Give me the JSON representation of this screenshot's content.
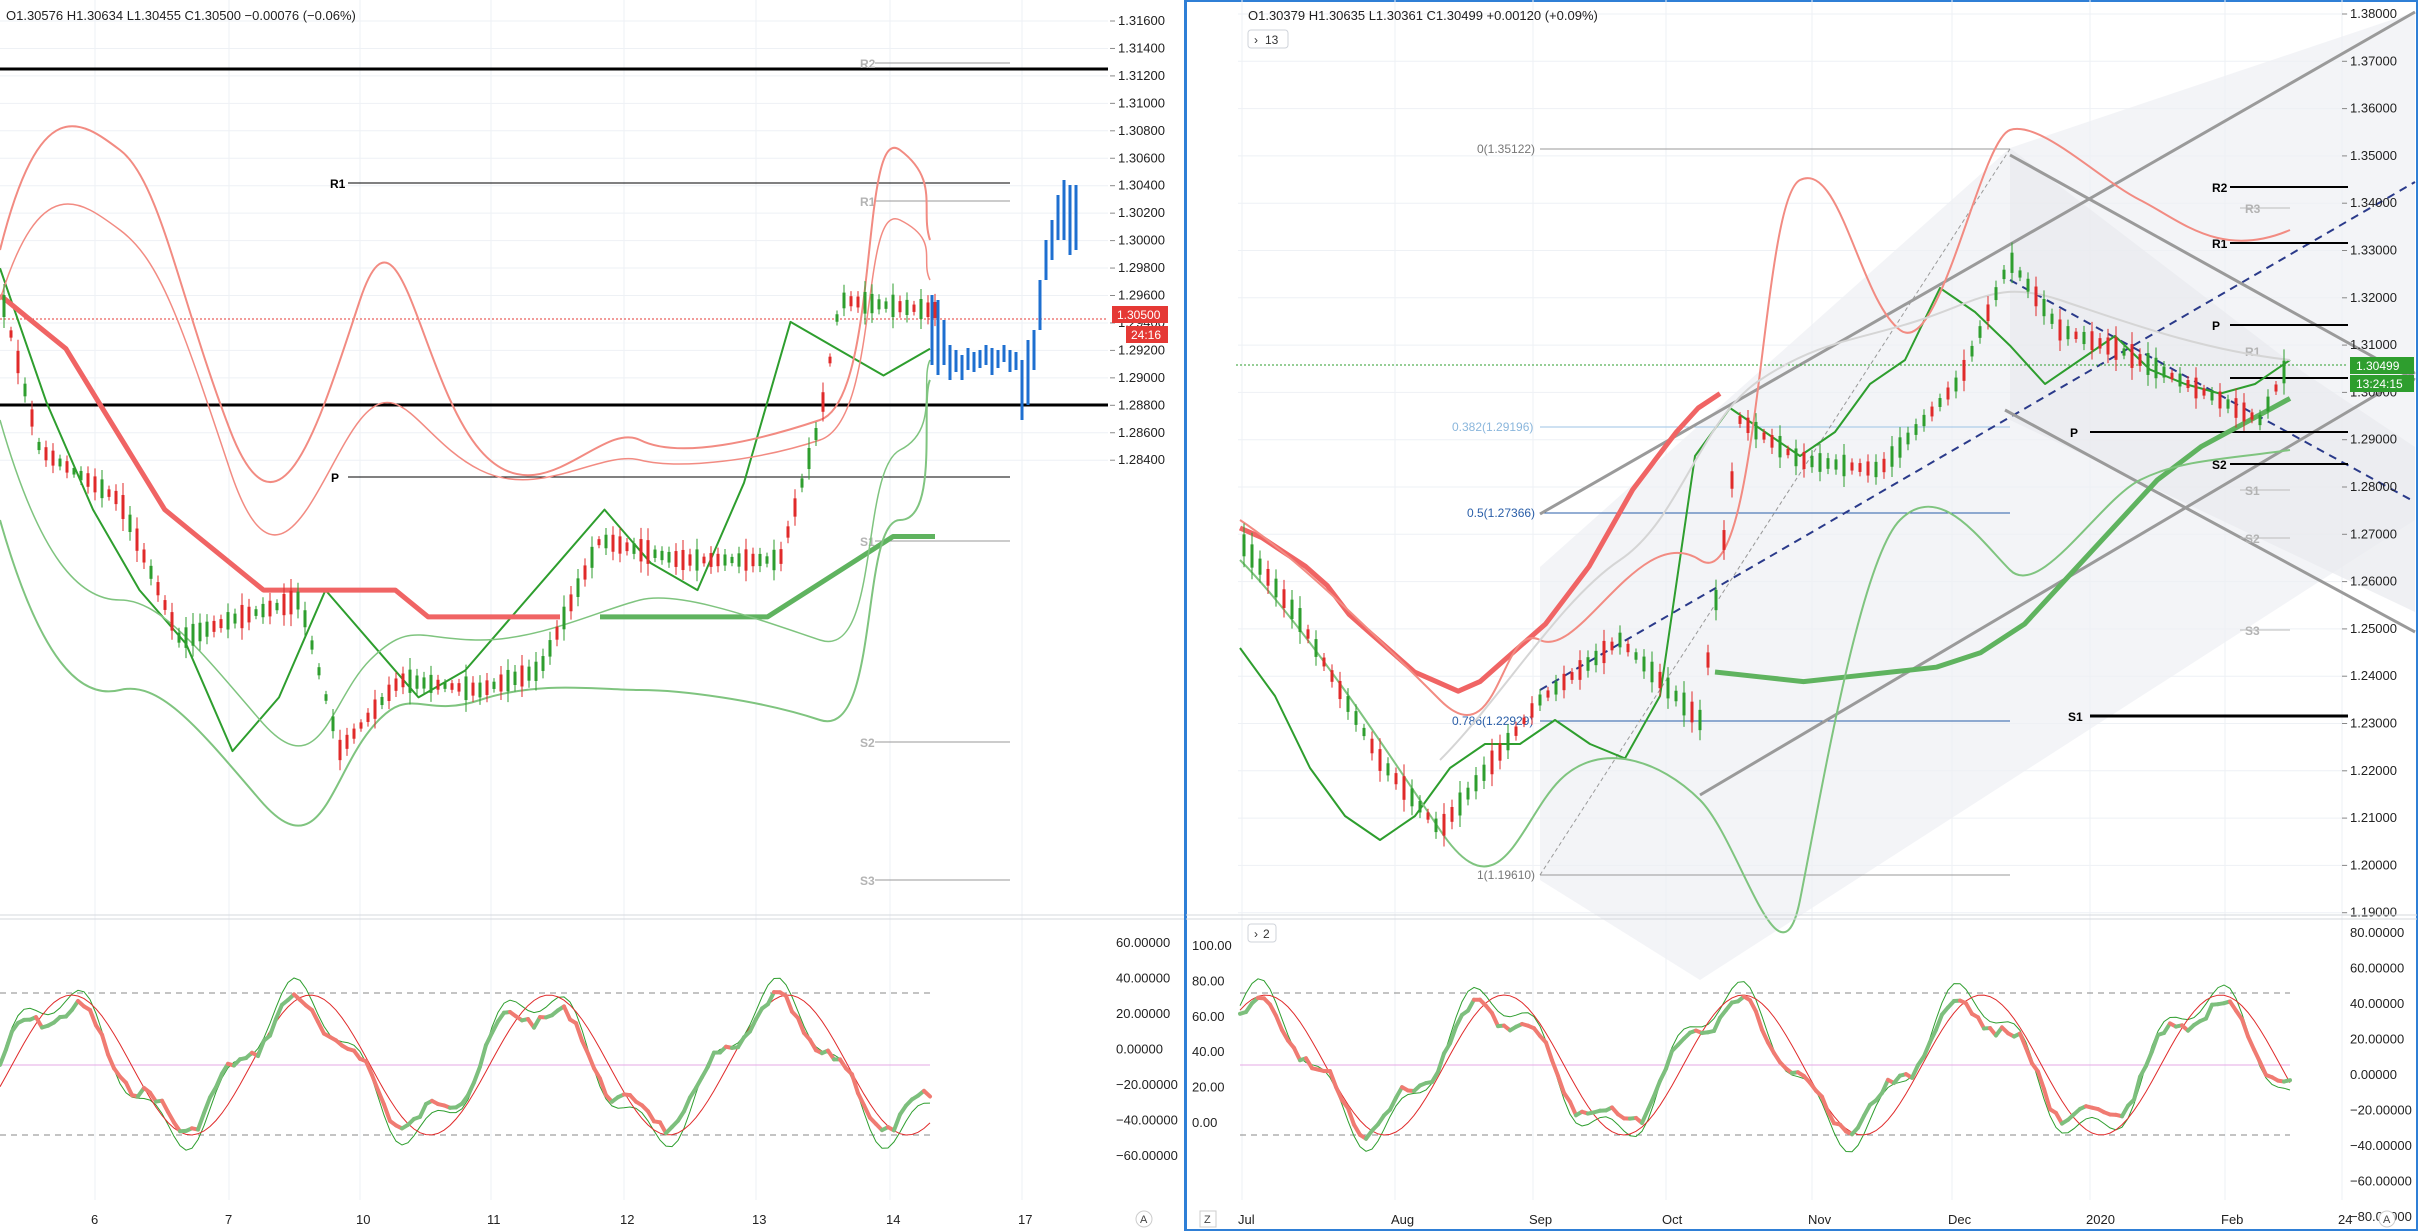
{
  "left_chart": {
    "ohlc": "O1.30576  H1.30634  L1.30455  C1.30500  −0.00076 (−0.06%)",
    "price_ticks": [
      "1.31600",
      "1.31400",
      "1.31200",
      "1.31000",
      "1.30800",
      "1.30600",
      "1.30400",
      "1.30200",
      "1.30000",
      "1.29800",
      "1.29600",
      "1.29400",
      "1.29200",
      "1.29000",
      "1.28800",
      "1.28600",
      "1.28400"
    ],
    "price_tag": "1.30500",
    "countdown_tag": "24:16",
    "date_ticks": [
      "6",
      "7",
      "10",
      "11",
      "12",
      "13",
      "14",
      "17"
    ],
    "pivot_labels": {
      "R1": "R1",
      "P": "P",
      "R2_faint": "R2",
      "R1_faint": "R1",
      "S1_faint": "S1",
      "S2_faint": "S2",
      "S3_faint": "S3"
    },
    "osc_ticks": [
      "60.00000",
      "40.00000",
      "20.00000",
      "0.00000",
      "−20.00000",
      "−40.00000",
      "−60.00000"
    ],
    "corner_button": "A"
  },
  "right_chart": {
    "ohlc": "O1.30379  H1.30635  L1.30361  C1.30499  +0.00120 (+0.09%)",
    "indicator_toggle": "13",
    "price_ticks": [
      "1.38000",
      "1.37000",
      "1.36000",
      "1.35000",
      "1.34000",
      "1.33000",
      "1.32000",
      "1.31000",
      "1.30000",
      "1.29000",
      "1.28000",
      "1.27000",
      "1.26000",
      "1.25000",
      "1.24000",
      "1.23000",
      "1.22000",
      "1.21000",
      "1.20000",
      "1.19000"
    ],
    "price_tag": "1.30499",
    "countdown_tag": "13:24:15",
    "date_ticks": [
      "Jul",
      "Aug",
      "Sep",
      "Oct",
      "Nov",
      "Dec",
      "2020",
      "Feb",
      "24"
    ],
    "fib_labels": [
      "0(1.35122)",
      "0.382(1.29196)",
      "0.5(1.27366)",
      "0.786(1.22929)",
      "1(1.19610)"
    ],
    "pivot_labels": {
      "R2": "R2",
      "R1": "R1",
      "P": "P",
      "S2": "S2",
      "S1": "S1",
      "R3_faint": "R3",
      "R2_faint": "R2",
      "R1_faint": "R1",
      "S1_faint": "S1",
      "S2_faint": "S2",
      "S3_faint": "S3"
    },
    "osc_toggle": "2",
    "osc_left_ticks": [
      "100.00",
      "80.00",
      "60.00",
      "40.00",
      "20.00",
      "0.00"
    ],
    "osc_right_ticks": [
      "80.00000",
      "60.00000",
      "40.00000",
      "20.00000",
      "0.00000",
      "−20.00000",
      "−40.00000",
      "−60.00000",
      "−80.00000"
    ],
    "corner_button_left": "Z",
    "corner_button_right": "A"
  },
  "colors": {
    "bull": "#2e9e2e",
    "bear": "#e02a2a",
    "ma_red": "#f06464",
    "ma_green": "#5fb35f",
    "band_red": "#f28b82",
    "band_green": "#7fc47f",
    "blue_bars": "#1e6fd0",
    "tag_red": "#e53935",
    "tag_green": "#2e9e2e",
    "panel_border": "#2f7fd6"
  },
  "chart_data": [
    {
      "type": "line",
      "title": "",
      "timeframe_labels": [
        "6",
        "7",
        "10",
        "11",
        "12",
        "13",
        "14",
        "17"
      ],
      "ylim": [
        1.283,
        1.317
      ],
      "last_close": 1.305,
      "series": [
        {
          "values": [
            1.307,
            1.302,
            1.298,
            1.295,
            1.293,
            1.289,
            1.291,
            1.295,
            1.293,
            1.291,
            1.292,
            1.294,
            1.296,
            1.298,
            1.296,
            1.295,
            1.299,
            1.305,
            1.304,
            1.303,
            1.304
          ]
        },
        {
          "values": [
            1.306,
            1.305,
            1.304,
            1.302,
            1.3,
            1.298,
            1.297,
            1.296,
            1.295,
            1.295,
            1.295,
            1.295,
            1.295,
            1.294,
            1.294,
            1.294,
            1.294,
            1.294
          ]
        },
        {
          "values": [
            1.294,
            1.294,
            1.294,
            1.294,
            1.294,
            1.295,
            1.296,
            1.297,
            1.297
          ]
        }
      ]
    },
    {
      "type": "line",
      "title": "",
      "timeframe_labels": [
        "Jul",
        "Aug",
        "Sep",
        "Oct",
        "Nov",
        "Dec",
        "2020",
        "Feb",
        "24"
      ],
      "ylim": [
        1.19,
        1.38
      ],
      "last_close": 1.30499,
      "series": [
        {
          "values": [
            1.245,
            1.235,
            1.22,
            1.21,
            1.205,
            1.21,
            1.22,
            1.225,
            1.225,
            1.23,
            1.225,
            1.222,
            1.235,
            1.285,
            1.295,
            1.29,
            1.285,
            1.29,
            1.3,
            1.305,
            1.32,
            1.315,
            1.308,
            1.3,
            1.305,
            1.31,
            1.303,
            1.3,
            1.298,
            1.3,
            1.305
          ]
        },
        {
          "values": [
            1.27,
            1.268,
            1.265,
            1.262,
            1.258,
            1.252,
            1.248,
            1.244,
            1.24,
            1.238,
            1.236,
            1.238,
            1.242,
            1.246,
            1.25,
            1.256,
            1.262,
            1.27,
            1.278,
            1.284,
            1.29,
            1.295,
            1.298
          ]
        },
        {
          "values": [
            1.24,
            1.239,
            1.238,
            1.239,
            1.24,
            1.241,
            1.244,
            1.25,
            1.26,
            1.27,
            1.28,
            1.287,
            1.292,
            1.297
          ]
        }
      ]
    }
  ]
}
